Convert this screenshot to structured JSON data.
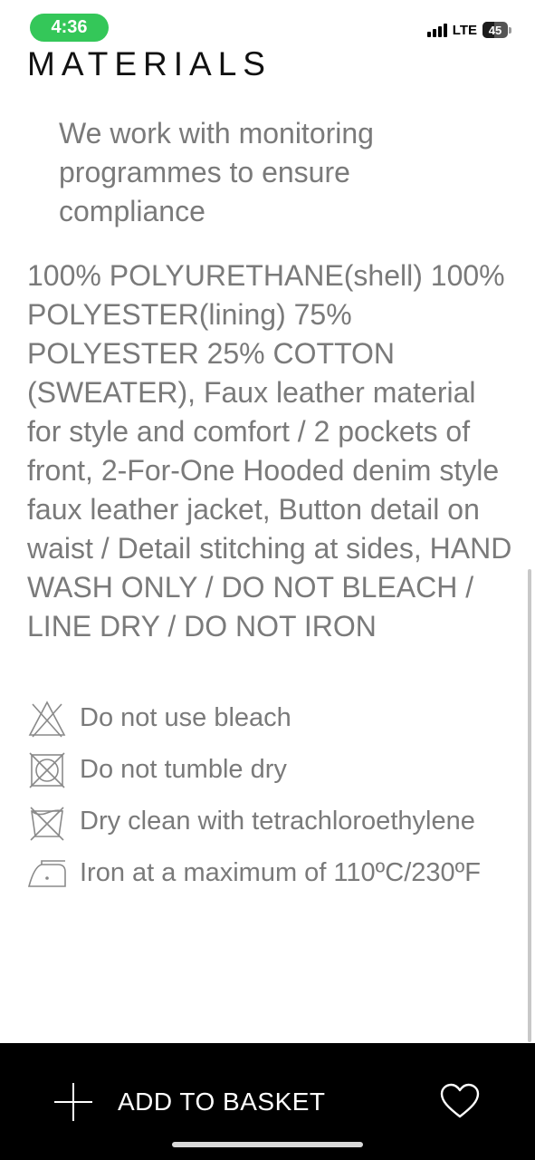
{
  "status_bar": {
    "time": "4:36",
    "network": "LTE",
    "battery_level": "45",
    "time_pill_color": "#34c759"
  },
  "section": {
    "title": "MATERIALS",
    "intro": "We work with monitoring programmes to ensure compliance",
    "composition": "100% POLYURETHANE(shell) 100% POLYESTER(lining) 75% POLYESTER 25% COTTON (SWEATER), Faux leather material for style and comfort / 2 pockets of front, 2-For-One Hooded denim style faux leather jacket, Button detail on waist / Detail stitching at sides, HAND WASH ONLY / DO NOT BLEACH / LINE DRY / DO NOT IRON"
  },
  "care": [
    {
      "icon": "no-bleach-icon",
      "label": "Do not use bleach"
    },
    {
      "icon": "no-tumble-dry-icon",
      "label": "Do not tumble dry"
    },
    {
      "icon": "dry-clean-icon",
      "label": "Dry clean with tetrachloroethylene"
    },
    {
      "icon": "iron-low-icon",
      "label": "Iron at a maximum of  110ºC/230ºF"
    }
  ],
  "bottom_bar": {
    "add_label": "ADD TO BASKET",
    "add_icon": "plus-icon",
    "wishlist_icon": "heart-icon"
  }
}
